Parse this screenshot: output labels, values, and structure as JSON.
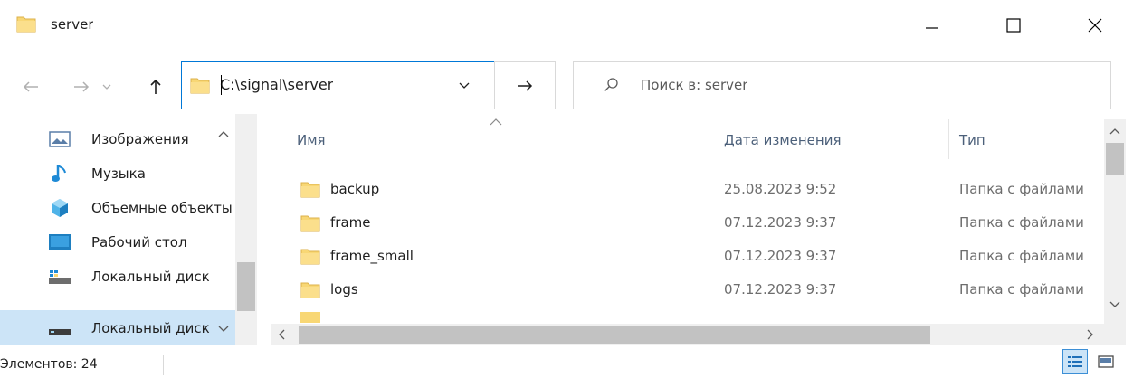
{
  "window": {
    "title": "server"
  },
  "titlebar": {
    "minimize_icon": "minimize-icon",
    "maximize_icon": "maximize-icon",
    "close_icon": "close-icon"
  },
  "address": {
    "path": "C:\\signal\\server"
  },
  "search": {
    "placeholder": "Поиск в: server"
  },
  "nav": {
    "items": [
      {
        "label": "Изображения",
        "icon": "pictures-icon"
      },
      {
        "label": "Музыка",
        "icon": "music-icon"
      },
      {
        "label": "Объемные объекты",
        "icon": "3d-objects-icon"
      },
      {
        "label": "Рабочий стол",
        "icon": "desktop-icon"
      },
      {
        "label": "Локальный диск",
        "icon": "local-disk-icon"
      },
      {
        "label": "Локальный диск",
        "icon": "local-disk-icon"
      }
    ]
  },
  "columns": {
    "name": "Имя",
    "date": "Дата изменения",
    "type": "Тип"
  },
  "files": [
    {
      "name": "backup",
      "date": "25.08.2023 9:52",
      "type": "Папка с файлами"
    },
    {
      "name": "frame",
      "date": "07.12.2023 9:37",
      "type": "Папка с файлами"
    },
    {
      "name": "frame_small",
      "date": "07.12.2023 9:37",
      "type": "Папка с файлами"
    },
    {
      "name": "logs",
      "date": "07.12.2023 9:37",
      "type": "Папка с файлами"
    }
  ],
  "status": {
    "count": "Элементов: 24"
  },
  "colors": {
    "accent": "#0078d7",
    "selection": "#cce4f7",
    "folder": "#f8d775"
  }
}
